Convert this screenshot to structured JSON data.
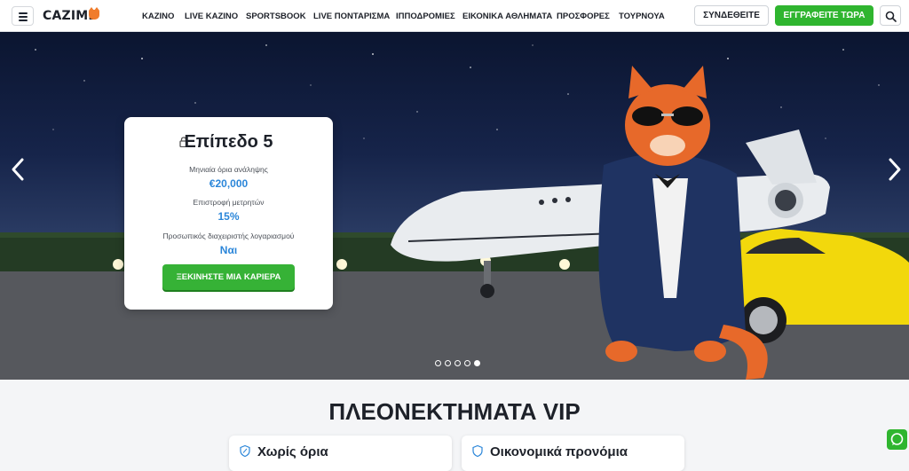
{
  "header": {
    "logo": "CAZIMB",
    "nav": [
      "ΚΑΖΙΝΟ",
      "LIVE ΚΑΖΙΝΟ",
      "SPORTSBOOK",
      "LIVE ΠΟΝΤΑΡΙΣΜΑ",
      "ΙΠΠΟΔΡΟΜΙΕΣ",
      "ΕΙΚΟΝΙΚΑ ΑΘΛΗΜΑΤΑ",
      "ΠΡΟΣΦΟΡΕΣ",
      "ΤΟΥΡΝΟΥΑ"
    ],
    "login_label": "ΣΥΝΔΕΘΕΙΤΕ",
    "register_label": "ΕΓΓΡΑΦΕΙΤΕ ΤΩΡΑ",
    "menu_icon": "hamburger-icon",
    "search_icon": "search-icon"
  },
  "hero": {
    "card": {
      "title": "Επίπεδο 5",
      "withdrawal_label": "Μηνιαία όρια ανάληψης",
      "withdrawal_value": "€20,000",
      "cashback_label": "Επιστροφή μετρητών",
      "cashback_value": "15%",
      "manager_label": "Προσωπικός διαχειριστής λογαριασμού",
      "manager_value": "Ναι",
      "cta_label": "ΞΕΚΙΝΗΣΤΕ ΜΙΑ ΚΑΡΙΕΡΑ"
    },
    "slide_count": 5,
    "active_slide": 5
  },
  "vip": {
    "title": "ΠΛΕΟΝΕΚΤΗΜΑΤΑ VIP",
    "cards": [
      "Χωρίς όρια",
      "Οικονομικά προνόμια"
    ]
  },
  "colors": {
    "brand_green": "#2fb52f",
    "value_blue": "#2b86d9",
    "logo_orange": "#f07c2c"
  }
}
